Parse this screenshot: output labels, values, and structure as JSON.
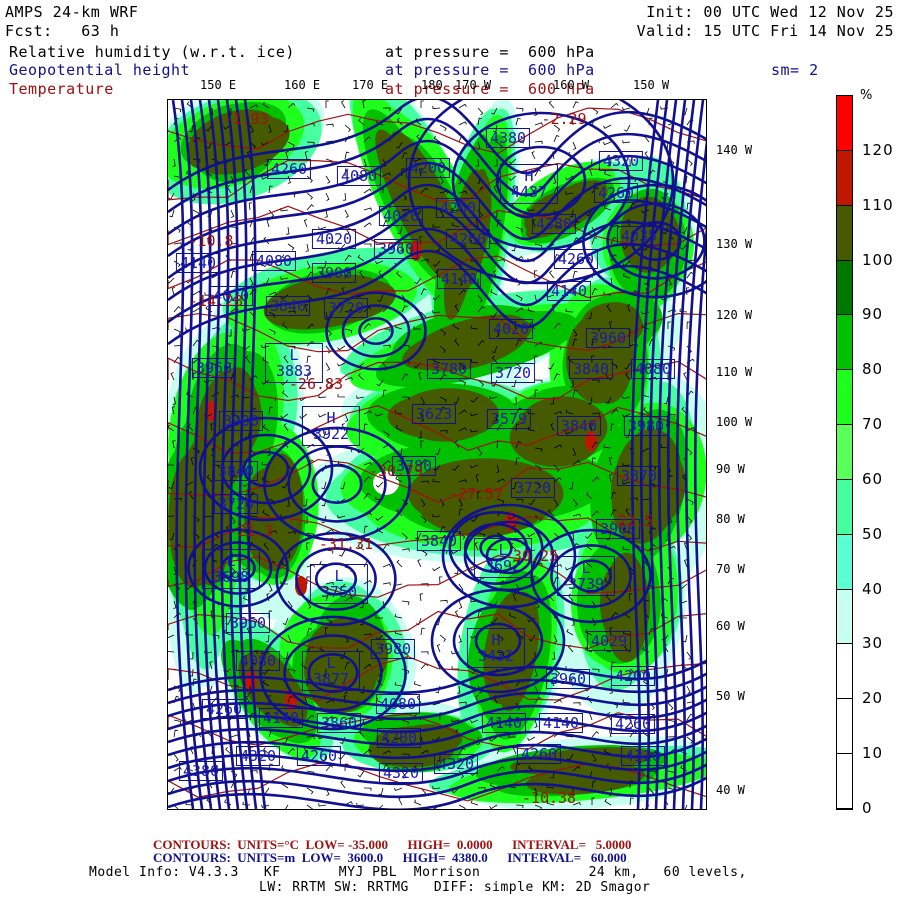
{
  "header": {
    "model": "AMPS 24-km WRF",
    "fcst": "Fcst:   63 h",
    "init": "Init: 00 UTC Wed 12 Nov 25",
    "valid": "Valid: 15 UTC Fri 14 Nov 25",
    "fields": [
      {
        "name": "Relative humidity (w.r.t. ice)",
        "level": "at pressure =  600 hPa",
        "color": "#000000"
      },
      {
        "name": "Geopotential height",
        "level": "at pressure =  600 hPa",
        "color": "#101090"
      },
      {
        "name": "Temperature",
        "level": "at pressure =  600 hPa",
        "color": "#a01010"
      }
    ],
    "smoothing": "sm= 2"
  },
  "longitude_labels": [
    "150 E",
    "160 E",
    "170 E",
    "180",
    "170 W",
    "160 W",
    "150 W"
  ],
  "latitude_labels": [
    "140 W",
    "130 W",
    "120 W",
    "110 W",
    "100 W",
    "90 W",
    "80 W",
    "70 W",
    "60 W",
    "50 W",
    "40 W"
  ],
  "colorbar": {
    "unit": "%",
    "labels": [
      "120",
      "110",
      "100",
      "90",
      "80",
      "70",
      "60",
      "50",
      "40",
      "30",
      "20",
      "10",
      "0"
    ],
    "colors": [
      "#ff0000",
      "#c01800",
      "#465a00",
      "#007800",
      "#00c000",
      "#1eff1e",
      "#5aff5a",
      "#46ffa0",
      "#5affd2",
      "#c8fff0",
      "#ffffff",
      "#ffffff",
      "#ffffff",
      "#ffffff"
    ]
  },
  "height_labels": [
    "4380",
    "4260",
    "4080",
    "4200",
    "4320",
    "H 4437",
    "4260",
    "4020",
    "4260",
    "4380",
    "4020",
    "3960",
    "4260",
    "4035",
    "4140",
    "4080",
    "3900",
    "4140",
    "4260",
    "4140",
    "4020",
    "3840",
    "3720",
    "4020",
    "3960",
    "3960",
    "L 3883",
    "3780",
    "3720",
    "3840",
    "4080",
    "3900",
    "H 3922",
    "3623",
    "3579",
    "3840",
    "3980",
    "3840",
    "3720",
    "3780",
    "3720",
    "3870",
    "3900",
    "3840",
    "L 3698",
    "L 3750",
    "L 3692",
    "L 3739",
    "3960",
    "4029",
    "3980",
    "H 3432",
    "4080",
    "L 3877",
    "3960",
    "4200",
    "4260",
    "4140",
    "3860",
    "4080",
    "4140",
    "4140",
    "4260",
    "4200",
    "4320",
    "4260",
    "4320",
    "4380",
    "4320",
    "4320",
    "4260"
  ],
  "temperature_labels": [
    "-2.29",
    "-1.93",
    "-10.8",
    "-14.28",
    "-26.83",
    "-30.79",
    "-27.57",
    "-31.31",
    "-10.38",
    "-30.25",
    "-22.5",
    "-21.3"
  ],
  "footer": {
    "temp_contours": "CONTOURS:  UNITS=°C  LOW= -35.000      HIGH=  0.0000      INTERVAL=   5.0000",
    "height_contours": "CONTOURS:  UNITS=m  LOW=  3600.0      HIGH=  4380.0      INTERVAL=   60.000",
    "model_info": "Model Info: V4.3.3   KF       MYJ PBL  Morrison             24 km,   60 levels,",
    "model_info2": "LW: RRTM SW: RRTMG   DIFF: simple KM: 2D Smagor"
  }
}
